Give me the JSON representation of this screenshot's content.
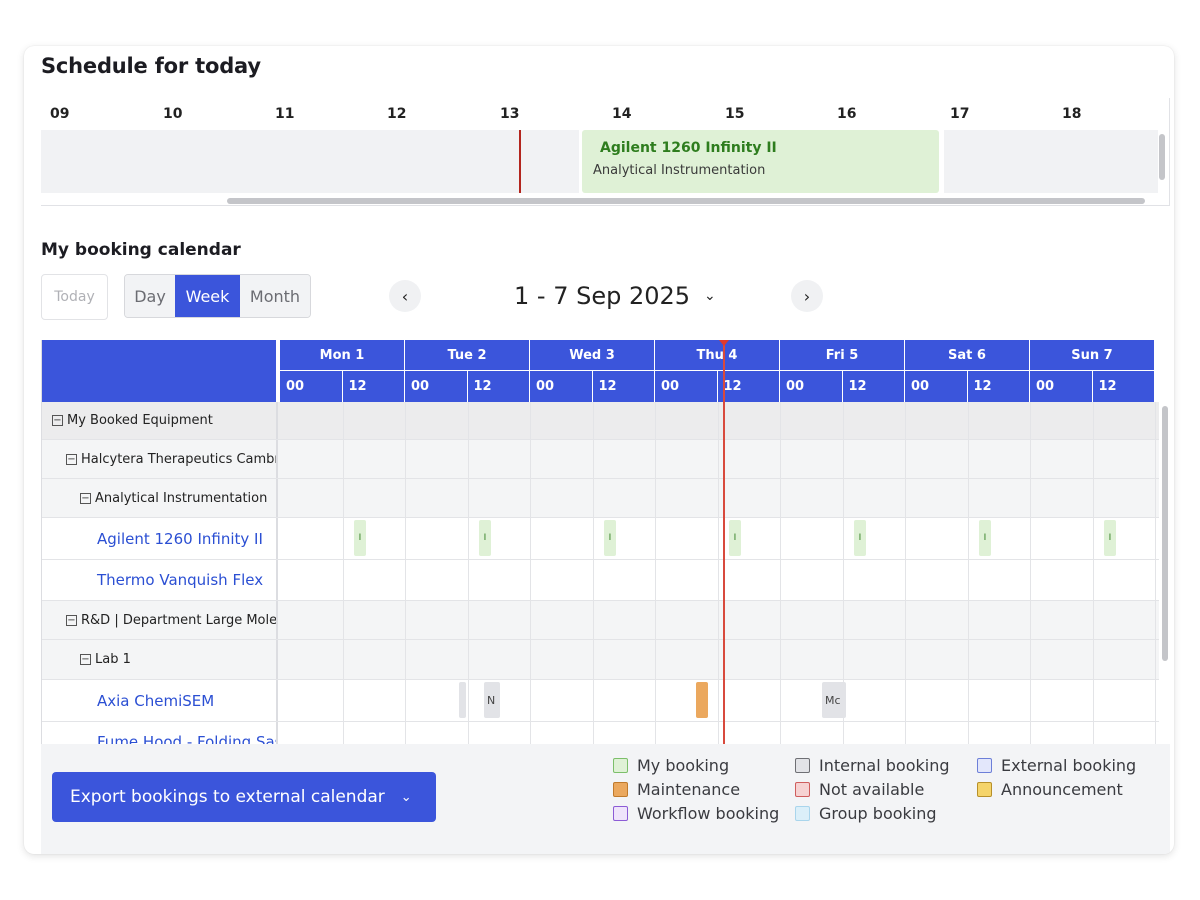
{
  "schedule": {
    "title": "Schedule for today",
    "hours": [
      "09",
      "10",
      "11",
      "12",
      "13",
      "14",
      "15",
      "16",
      "17",
      "18"
    ],
    "booking": {
      "title": "Agilent 1260 Infinity II",
      "subtitle": "Analytical Instrumentation"
    }
  },
  "calendar": {
    "title": "My booking calendar",
    "today_label": "Today",
    "views": [
      "Day",
      "Week",
      "Month"
    ],
    "active_view": "Week",
    "date_range": "1 - 7 Sep 2025",
    "days": [
      "Mon 1",
      "Tue 2",
      "Wed 3",
      "Thu 4",
      "Fri 5",
      "Sat 6",
      "Sun 7"
    ],
    "half_labels": [
      "00",
      "12"
    ],
    "rows": [
      {
        "label": "My Booked Equipment",
        "kind": "top",
        "indent": 0,
        "toggle": true
      },
      {
        "label": "Halcytera Therapeutics Cambr",
        "kind": "group",
        "indent": 1,
        "toggle": true
      },
      {
        "label": "Analytical Instrumentation",
        "kind": "group",
        "indent": 2,
        "toggle": true
      },
      {
        "label": "Agilent 1260 Infinity II",
        "kind": "item",
        "indent": 3,
        "toggle": false
      },
      {
        "label": "Thermo Vanquish Flex",
        "kind": "item",
        "indent": 3,
        "toggle": false
      },
      {
        "label": "R&D | Department Large Molec",
        "kind": "group",
        "indent": 1,
        "toggle": true
      },
      {
        "label": "Lab 1",
        "kind": "group",
        "indent": 2,
        "toggle": true
      },
      {
        "label": "Axia ChemiSEM",
        "kind": "item",
        "indent": 3,
        "toggle": false
      },
      {
        "label": "Fume Hood - Folding Sas",
        "kind": "item",
        "indent": 3,
        "toggle": false
      }
    ],
    "event_text": {
      "green_mark": "I",
      "grey_short": "N",
      "grey_long": "Mc",
      "orange_mark": "•"
    }
  },
  "footer": {
    "export_label": "Export bookings to external calendar",
    "legend": [
      {
        "label": "My booking",
        "color": "#dff1d6",
        "border": "#7cbf6a"
      },
      {
        "label": "Internal booking",
        "color": "#e2e3e7",
        "border": "#6e6f74"
      },
      {
        "label": "External booking",
        "color": "#e3e7fb",
        "border": "#6d7fd8"
      },
      {
        "label": "Maintenance",
        "color": "#eba85e",
        "border": "#c07a2c"
      },
      {
        "label": "Not available",
        "color": "#f6d2d2",
        "border": "#cf5d5d"
      },
      {
        "label": "Announcement",
        "color": "#f5d46a",
        "border": "#b7902a"
      },
      {
        "label": "Workflow booking",
        "color": "#efe4fb",
        "border": "#8c5bd6"
      },
      {
        "label": "Group booking",
        "color": "#dbeff9",
        "border": "#a9d5ec"
      }
    ]
  },
  "colors": {
    "accent": "#3b55db",
    "now_line": "#d84a3d"
  }
}
